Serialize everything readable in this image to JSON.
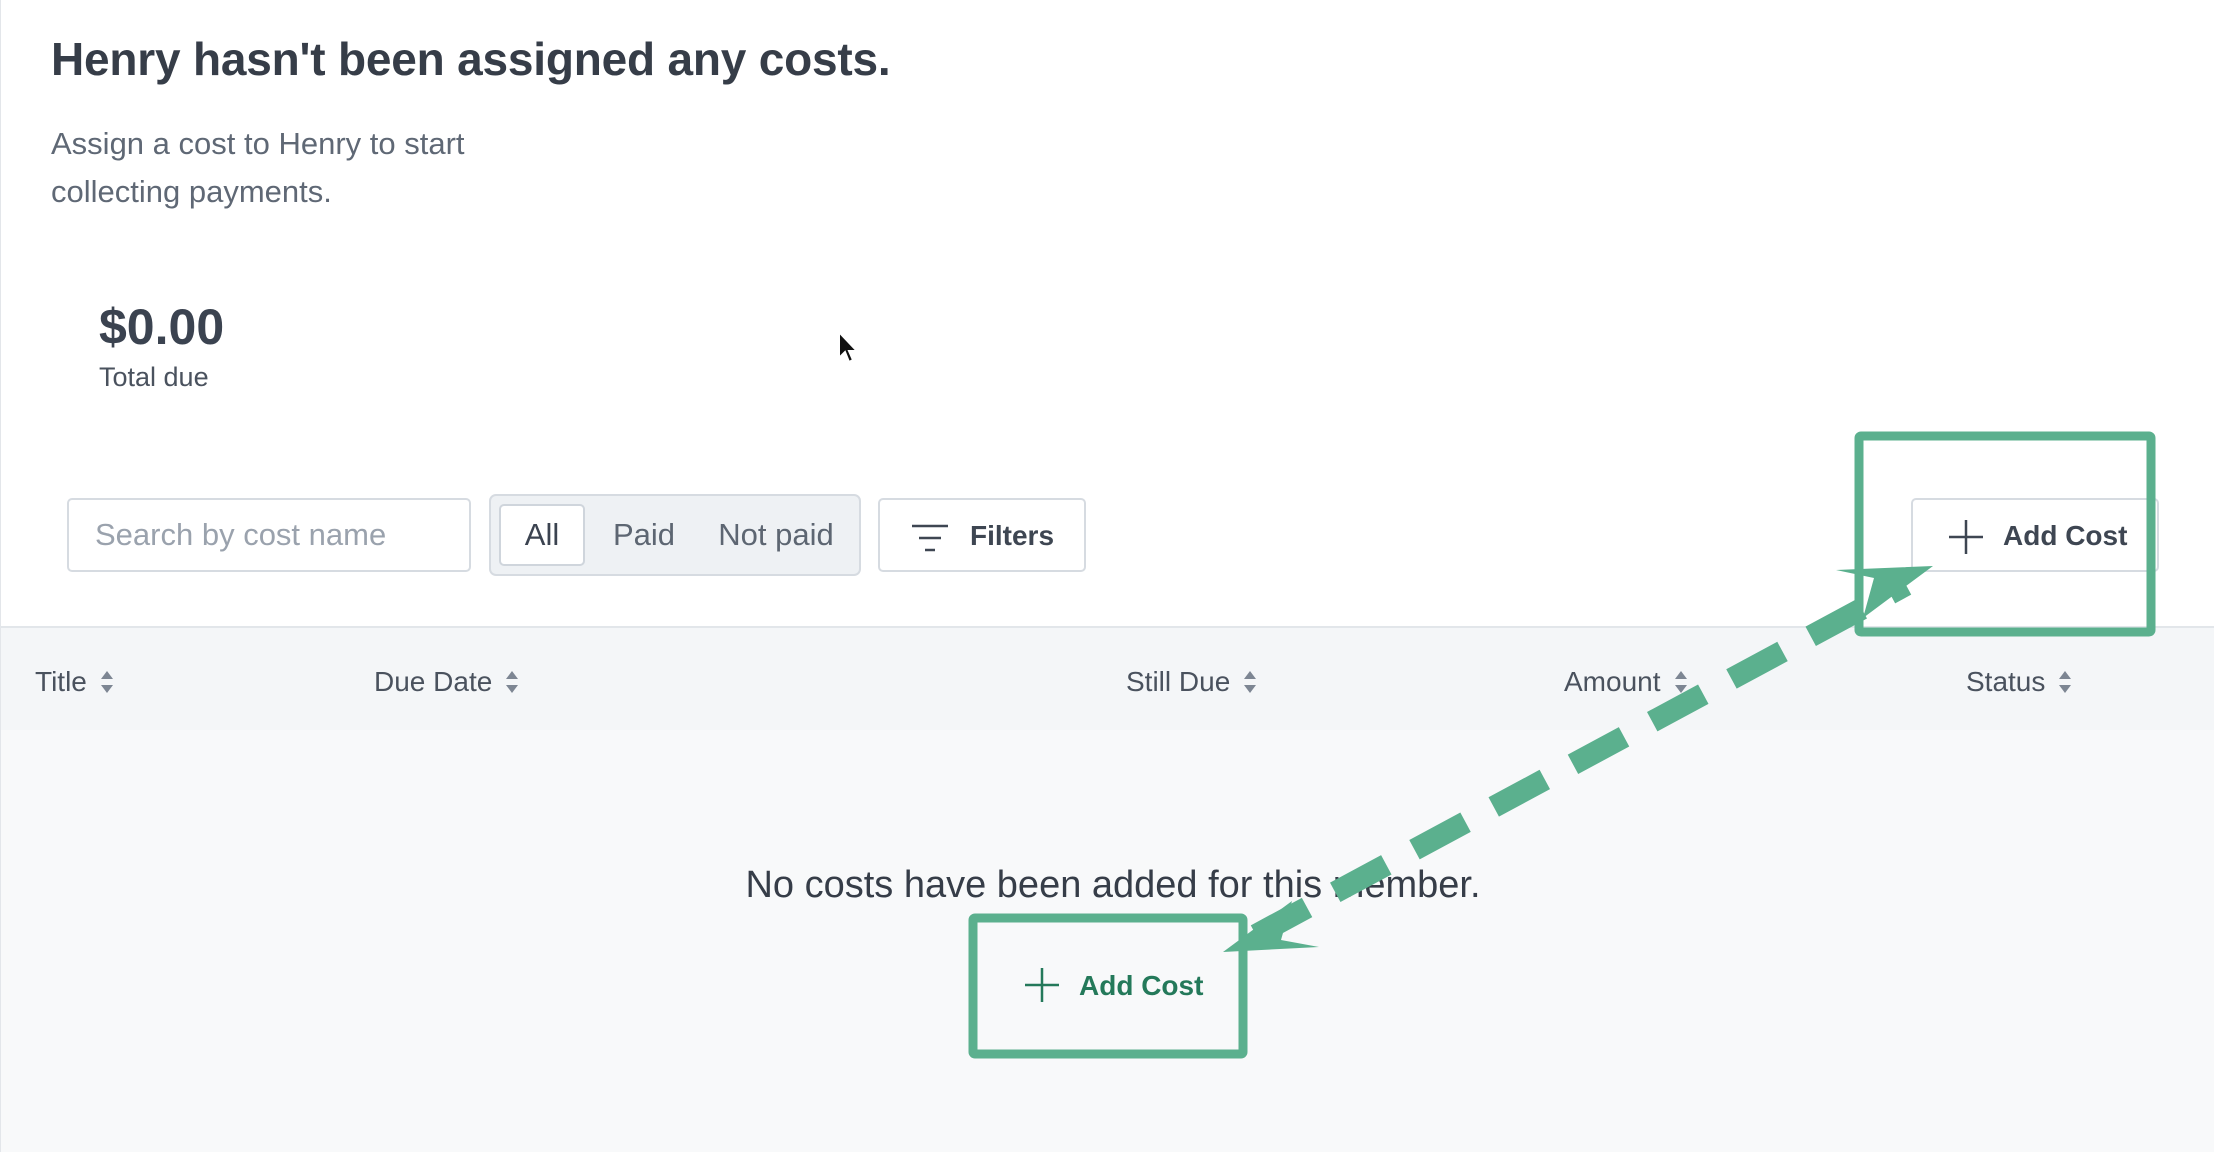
{
  "header": {
    "title": "Henry hasn't been assigned any costs.",
    "subtitle": "Assign a cost to Henry to start collecting payments."
  },
  "summary": {
    "total_amount": "$0.00",
    "total_label": "Total due"
  },
  "toolbar": {
    "search_placeholder": "Search by cost name",
    "segments": [
      {
        "label": "All",
        "active": true
      },
      {
        "label": "Paid",
        "active": false
      },
      {
        "label": "Not paid",
        "active": false
      }
    ],
    "filters_label": "Filters",
    "filters_icon": "filter-lines-icon",
    "add_cost_label": "Add Cost",
    "add_cost_icon": "plus-icon"
  },
  "table": {
    "columns": [
      "Title",
      "Due Date",
      "Still Due",
      "Amount",
      "Status"
    ],
    "sort_icon": "sort-arrows-icon",
    "empty_message": "No costs have been added for this member.",
    "empty_add_cost_label": "Add Cost"
  },
  "colors": {
    "annotation_green": "#5bb08e",
    "accent_green": "#24795a",
    "header_bg": "#f4f6f8",
    "body_bg": "#f8f9fa"
  }
}
